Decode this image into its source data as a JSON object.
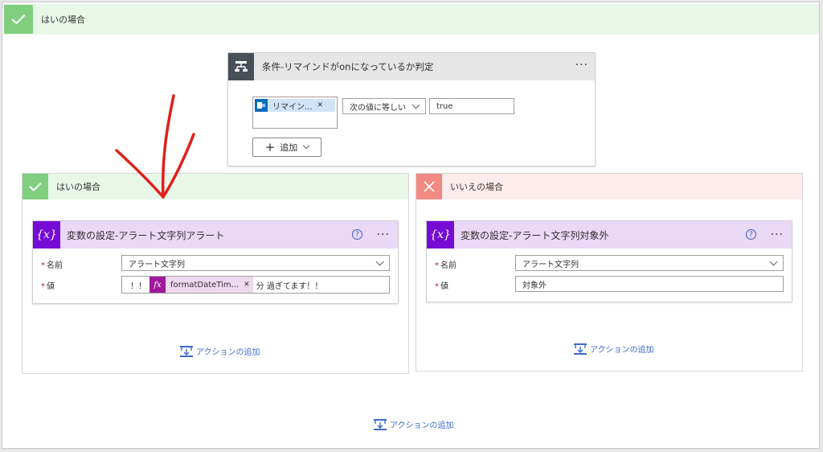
{
  "outer_branch": {
    "label": "はいの場合",
    "add_action": "アクションの追加"
  },
  "condition": {
    "title": "条件-リマインドがonになっているか判定",
    "token_label": "リマイン...",
    "operator": "次の値に等しい",
    "value": "true",
    "add_button": "追加"
  },
  "yes_branch": {
    "label": "はいの場合",
    "card_title": "変数の設定-アラート文字列アラート",
    "name_label": "名前",
    "name_value": "アラート文字列",
    "value_label": "値",
    "value_prefix": "！！",
    "token_label": "formatDateTim...",
    "value_suffix": "分 過ぎてます！！",
    "add_action": "アクションの追加"
  },
  "no_branch": {
    "label": "いいえの場合",
    "card_title": "変数の設定-アラート文字列対象外",
    "name_label": "名前",
    "name_value": "アラート文字列",
    "value_label": "値",
    "value_value": "対象外",
    "add_action": "アクションの追加"
  },
  "annotation": {
    "color": "#e0201b",
    "icon": "red-arrow-annotation"
  },
  "colors": {
    "yes": "#7fcf7f",
    "no": "#f08a82",
    "variable": "#770bd6",
    "condition": "#484f58",
    "link": "#3d6bc6"
  }
}
